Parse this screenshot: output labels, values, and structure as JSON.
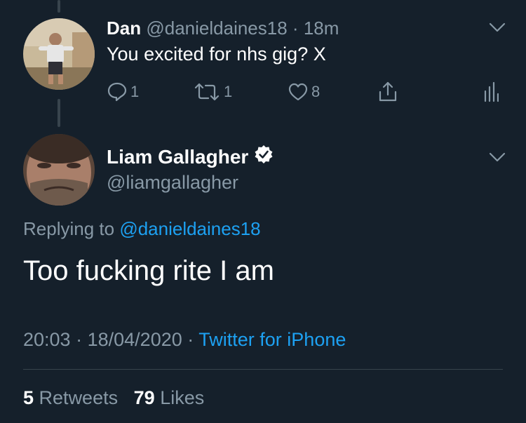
{
  "parent_tweet": {
    "display_name": "Dan",
    "handle": "@danieldaines18",
    "separator": "·",
    "time_ago": "18m",
    "text": "You excited for nhs gig? X",
    "actions": {
      "reply_count": "1",
      "retweet_count": "1",
      "like_count": "8"
    },
    "icons": [
      "reply-icon",
      "retweet-icon",
      "like-icon",
      "share-icon",
      "analytics-icon",
      "chevron-down-icon"
    ]
  },
  "main_tweet": {
    "display_name": "Liam Gallagher",
    "handle": "@liamgallagher",
    "replying_prefix": "Replying to",
    "replying_to": "@danieldaines18",
    "text": "Too fucking rite I am",
    "time": "20:03",
    "date": "18/04/2020",
    "source": "Twitter for iPhone",
    "meta_separator": "·",
    "retweets_count": "5",
    "retweets_label": "Retweets",
    "likes_count": "79",
    "likes_label": "Likes",
    "icons": [
      "verified-badge-icon",
      "chevron-down-icon"
    ]
  },
  "colors": {
    "background": "#15202b",
    "muted": "#8899a6",
    "link": "#1da1f2",
    "divider": "#38444d"
  }
}
